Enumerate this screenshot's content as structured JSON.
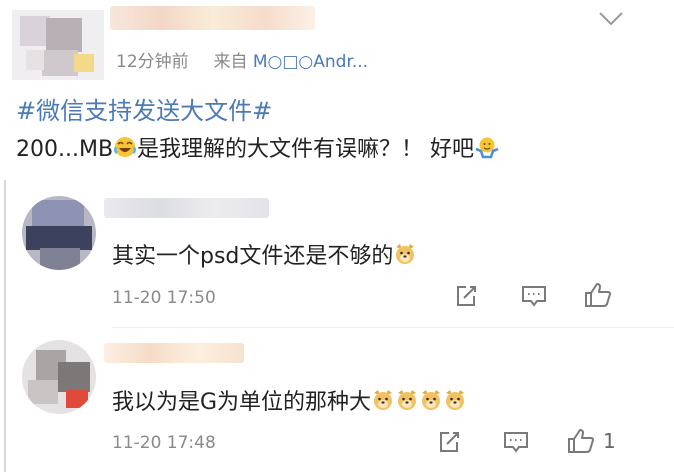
{
  "post": {
    "meta_time": "12分钟前",
    "meta_source_prefix": "来自",
    "meta_source_device": "M○□○Andr...",
    "hashtag": "#微信支持发送大文件#",
    "text_part1": "200...MB",
    "text_part2": "是我理解的大文件有误嘛？！ 好吧"
  },
  "comments": [
    {
      "text": "其实一个psd文件还是不够的",
      "time": "11-20 17:50",
      "like_count": ""
    },
    {
      "text": "我以为是G为单位的那种大",
      "time": "11-20 17:48",
      "like_count": "1"
    }
  ],
  "icons": {
    "more": "chevron-down-icon",
    "repost": "edit-repost-icon",
    "comment": "comment-icon",
    "like": "thumbs-up-icon"
  },
  "colors": {
    "hashtag": "#4a7ab8",
    "meta_gray": "#8a8a8a",
    "icon_gray": "#7a7a7a"
  }
}
